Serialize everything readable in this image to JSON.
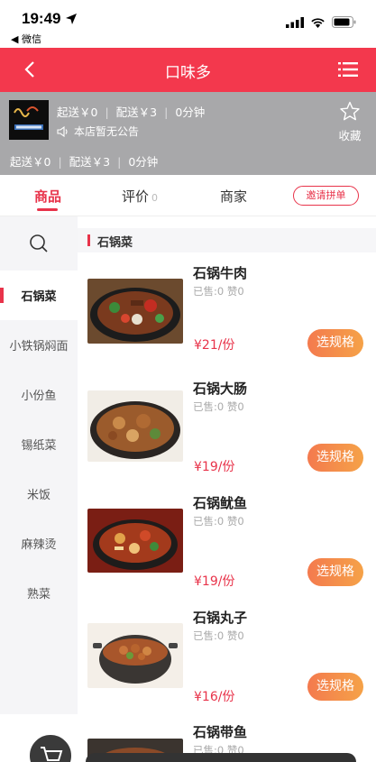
{
  "status_bar": {
    "time": "19:49",
    "back_app": "◀ 微信"
  },
  "nav": {
    "title": "口味多"
  },
  "shop": {
    "min_order": "起送￥0",
    "delivery_fee": "配送￥3",
    "delivery_time": "0分钟",
    "notice": "本店暂无公告",
    "favorite_label": "收藏",
    "logo_text": "口味多"
  },
  "tabs": {
    "goods": "商品",
    "review": "评价",
    "review_count": "0",
    "merchant": "商家",
    "invite": "邀请拼单"
  },
  "sidebar": {
    "items": [
      {
        "label": "石锅菜",
        "active": true
      },
      {
        "label": "小铁锅焖面"
      },
      {
        "label": "小份鱼"
      },
      {
        "label": "锡纸菜"
      },
      {
        "label": "米饭"
      },
      {
        "label": "麻辣烫"
      },
      {
        "label": "熟菜"
      }
    ]
  },
  "category": {
    "title": "石锅菜"
  },
  "products": [
    {
      "name": "石锅牛肉",
      "stats": "已售:0 赞0",
      "price": "¥21/份",
      "button": "选规格"
    },
    {
      "name": "石锅大肠",
      "stats": "已售:0 赞0",
      "price": "¥19/份",
      "button": "选规格"
    },
    {
      "name": "石锅鱿鱼",
      "stats": "已售:0 赞0",
      "price": "¥19/份",
      "button": "选规格"
    },
    {
      "name": "石锅丸子",
      "stats": "已售:0 赞0",
      "price": "¥16/份",
      "button": "选规格"
    },
    {
      "name": "石锅带鱼",
      "stats": "已售:0 赞0",
      "price": "",
      "button": ""
    }
  ],
  "colors": {
    "accent": "#f3384d",
    "button_gradient_start": "#f47a4e",
    "button_gradient_end": "#f5a248"
  }
}
